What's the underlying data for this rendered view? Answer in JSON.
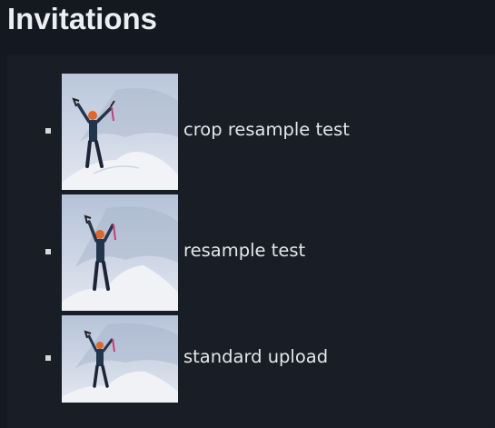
{
  "page": {
    "title": "Invitations"
  },
  "invitations": [
    {
      "label": "crop resample test",
      "image": "climber-on-snowy-summit-photo"
    },
    {
      "label": "resample test",
      "image": "climber-on-snowy-summit-photo"
    },
    {
      "label": "standard upload",
      "image": "climber-on-snowy-summit-photo"
    }
  ],
  "colors": {
    "background": "#141820",
    "panel": "#191d25",
    "text": "#e4e6ea",
    "bullet": "#d4d7dc"
  }
}
